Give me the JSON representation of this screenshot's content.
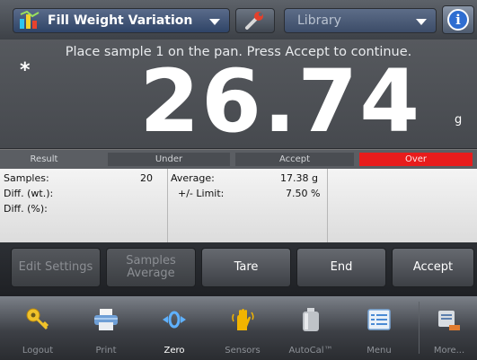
{
  "header": {
    "app_title": "Fill Weight Variation",
    "library_label": "Library",
    "info_glyph": "i"
  },
  "display": {
    "instruction": "Place sample  1 on the pan. Press Accept to continue.",
    "stable_symbol": "*",
    "reading": "26.74",
    "unit": "g"
  },
  "result_bar": {
    "result_label": "Result",
    "under_label": "Under",
    "accept_label": "Accept",
    "over_label": "Over",
    "over_color": "#e81c1c"
  },
  "stats": {
    "samples_label": "Samples:",
    "samples_value": "20",
    "diff_wt_label": "Diff. (wt.):",
    "diff_pct_label": "Diff. (%):",
    "average_label": "Average:",
    "average_value": "17.38 g",
    "limit_label": "+/- Limit:",
    "limit_value": "7.50 %"
  },
  "actions": {
    "edit_settings": "Edit Settings",
    "samples_average_line1": "Samples",
    "samples_average_line2": "Average",
    "tare": "Tare",
    "end": "End",
    "accept": "Accept"
  },
  "toolbar": {
    "logout": "Logout",
    "print": "Print",
    "zero": "Zero",
    "sensors": "Sensors",
    "autocal": "AutoCal™",
    "menu": "Menu",
    "more": "More..."
  },
  "icons": {
    "app": "fill-weight-icon",
    "tools": "wrench-icon",
    "info": "info-icon",
    "logout": "key-icon",
    "print": "printer-icon",
    "zero": "zero-arrows-icon",
    "sensors": "hand-sensor-icon",
    "autocal": "calibration-weight-icon",
    "menu": "menu-list-icon",
    "more": "more-icon"
  }
}
